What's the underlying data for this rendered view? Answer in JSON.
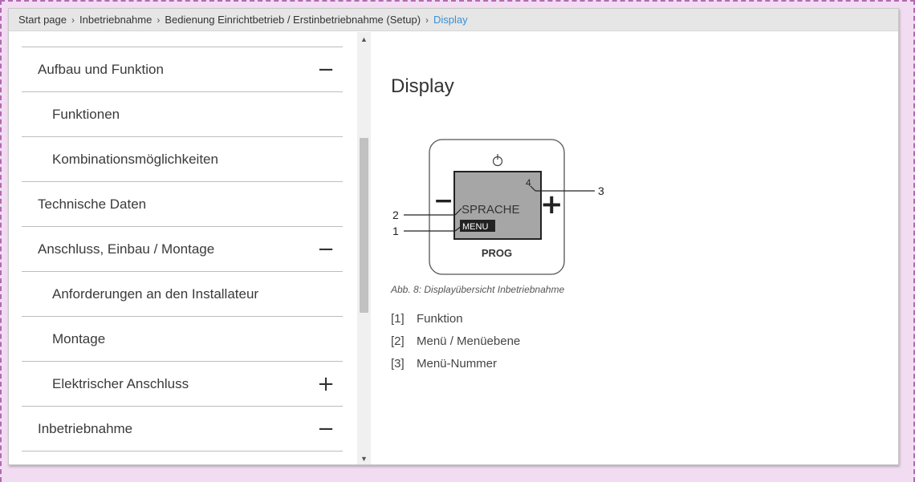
{
  "breadcrumb": {
    "items": [
      "Start page",
      "Inbetriebnahme",
      "Bedienung Einrichtbetrieb / Erstinbetriebnahme (Setup)"
    ],
    "current": "Display",
    "separator": "›"
  },
  "sidebar": {
    "items": [
      {
        "label": "Aufbau und Funktion",
        "level": 0,
        "toggle": "−"
      },
      {
        "label": "Funktionen",
        "level": 1,
        "toggle": ""
      },
      {
        "label": "Kombinationsmöglichkeiten",
        "level": 1,
        "toggle": ""
      },
      {
        "label": "Technische Daten",
        "level": 0,
        "toggle": ""
      },
      {
        "label": "Anschluss, Einbau / Montage",
        "level": 0,
        "toggle": "−"
      },
      {
        "label": "Anforderungen an den Installateur",
        "level": 1,
        "toggle": ""
      },
      {
        "label": "Montage",
        "level": 1,
        "toggle": ""
      },
      {
        "label": "Elektrischer Anschluss",
        "level": 1,
        "toggle": "+"
      },
      {
        "label": "Inbetriebnahme",
        "level": 0,
        "toggle": "−"
      }
    ]
  },
  "scrollbar": {
    "up": "▲",
    "down": "▼"
  },
  "content": {
    "title": "Display",
    "figure": {
      "screen_text": "SPRACHE",
      "menu_text": "MENU",
      "menu_number": "4",
      "prog_label": "PROG",
      "minus": "−",
      "plus": "+",
      "callouts": [
        "1",
        "2",
        "3"
      ]
    },
    "caption": "Abb. 8: Displayübersicht Inbetriebnahme",
    "legend": [
      {
        "idx": "[1]",
        "text": "Funktion"
      },
      {
        "idx": "[2]",
        "text": "Menü / Menüebene"
      },
      {
        "idx": "[3]",
        "text": "Menü-Nummer"
      }
    ]
  },
  "colors": {
    "link_current": "#3a8fd1",
    "page_bg": "#f2dcf2",
    "screen_gray": "#a6a6a6"
  }
}
